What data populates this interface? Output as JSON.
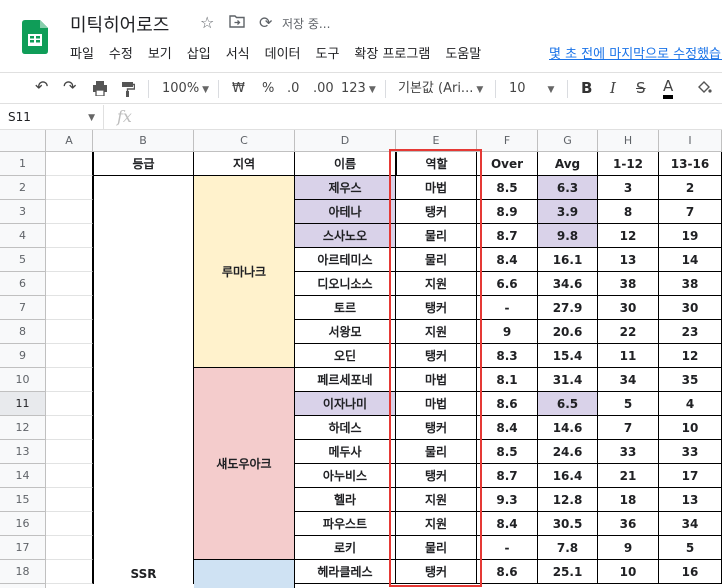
{
  "app": {
    "doc_title": "미틱히어로즈",
    "save_status": "저장 중...",
    "last_edit": "몇 초 전에 마지막으로 수정했습니다",
    "menu": [
      "파일",
      "수정",
      "보기",
      "삽입",
      "서식",
      "데이터",
      "도구",
      "확장 프로그램",
      "도움말"
    ]
  },
  "toolbar": {
    "zoom": "100%",
    "currency": "₩",
    "percent": "%",
    "dec_less": ".0",
    "dec_more": ".00",
    "format_more": "123",
    "font": "기본값 (Ari...",
    "size": "10",
    "bold": "B",
    "italic": "I",
    "strike": "S",
    "text_color": "A"
  },
  "formula": {
    "namebox": "S11",
    "fx": "fx",
    "value": ""
  },
  "columns": [
    "A",
    "B",
    "C",
    "D",
    "E",
    "F",
    "G",
    "H",
    "I"
  ],
  "rows": [
    [
      "",
      "등급",
      "지역",
      "이름",
      "역할",
      "Over",
      "Avg",
      "1-12",
      "13-16"
    ],
    [
      "",
      "",
      "",
      "제우스",
      "마법",
      "8.5",
      "6.3",
      "3",
      "2"
    ],
    [
      "",
      "",
      "",
      "아테나",
      "탱커",
      "8.9",
      "3.9",
      "8",
      "7"
    ],
    [
      "",
      "",
      "",
      "스사노오",
      "물리",
      "8.7",
      "9.8",
      "12",
      "19"
    ],
    [
      "",
      "",
      "",
      "아르테미스",
      "물리",
      "8.4",
      "16.1",
      "13",
      "14"
    ],
    [
      "",
      "",
      "",
      "디오니소스",
      "지원",
      "6.6",
      "34.6",
      "38",
      "38"
    ],
    [
      "",
      "",
      "",
      "토르",
      "탱커",
      "-",
      "27.9",
      "30",
      "30"
    ],
    [
      "",
      "",
      "",
      "서왕모",
      "지원",
      "9",
      "20.6",
      "22",
      "23"
    ],
    [
      "",
      "",
      "",
      "오딘",
      "탱커",
      "8.3",
      "15.4",
      "11",
      "12"
    ],
    [
      "",
      "",
      "",
      "페르세포네",
      "마법",
      "8.1",
      "31.4",
      "34",
      "35"
    ],
    [
      "",
      "",
      "",
      "이자나미",
      "마법",
      "8.6",
      "6.5",
      "5",
      "4"
    ],
    [
      "",
      "",
      "",
      "하데스",
      "탱커",
      "8.4",
      "14.6",
      "7",
      "10"
    ],
    [
      "",
      "",
      "",
      "메두사",
      "물리",
      "8.5",
      "24.6",
      "33",
      "33"
    ],
    [
      "",
      "",
      "",
      "아누비스",
      "탱커",
      "8.7",
      "16.4",
      "21",
      "17"
    ],
    [
      "",
      "",
      "",
      "헬라",
      "지원",
      "9.3",
      "12.8",
      "18",
      "13"
    ],
    [
      "",
      "",
      "",
      "파우스트",
      "지원",
      "8.4",
      "30.5",
      "36",
      "34"
    ],
    [
      "",
      "",
      "",
      "로키",
      "물리",
      "-",
      "7.8",
      "9",
      "5"
    ],
    [
      "",
      "SSR",
      "",
      "헤라클레스",
      "탱커",
      "8.6",
      "25.1",
      "10",
      "16"
    ]
  ],
  "merged": {
    "region1": "루마나크",
    "region2": "섀도우아크"
  },
  "colors": {
    "region1": "#fff2cc",
    "region2": "#f4cccc",
    "region3": "#cfe2f3",
    "lavender": "#d9d2e9",
    "highlight": "#e53935",
    "selected_row": "11"
  }
}
